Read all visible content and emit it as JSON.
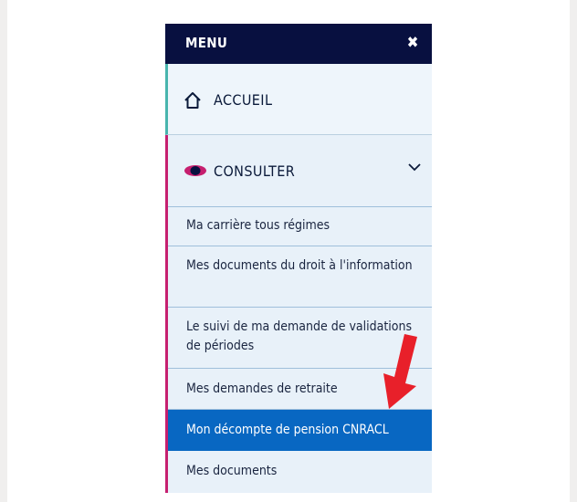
{
  "menu": {
    "title": "MENU",
    "close_icon": "close-icon",
    "home": {
      "label": "ACCUEIL",
      "icon": "home-icon"
    },
    "consult": {
      "label": "CONSULTER",
      "icon": "eye-icon",
      "expanded": true,
      "items": [
        {
          "label": "Ma carrière tous régimes"
        },
        {
          "label": "Mes documents du droit à l'information"
        },
        {
          "label": "Le suivi de ma demande de validations de périodes"
        },
        {
          "label": "Mes demandes de retraite"
        },
        {
          "label": "Mon décompte de pension CNRACL",
          "active": true
        },
        {
          "label": "Mes documents"
        }
      ]
    }
  },
  "colors": {
    "header_bg": "#081040",
    "menu_bg": "#e8f1f9",
    "active_bg": "#0867c2",
    "home_accent": "#48b5ad",
    "consult_accent": "#c61f6f",
    "arrow": "#e8202a"
  }
}
